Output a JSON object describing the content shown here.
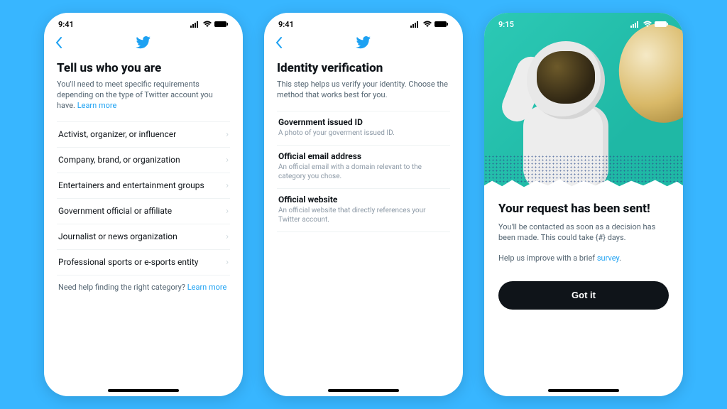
{
  "phone1": {
    "time": "9:41",
    "header_logo": "twitter",
    "title": "Tell us who you are",
    "desc_pre": "You'll need to meet specific requirements depending on the type of Twitter account you have. ",
    "learn_more": "Learn more",
    "categories": [
      "Activist, organizer, or influencer",
      "Company, brand, or organization",
      "Entertainers and entertainment groups",
      "Government official or affiliate",
      "Journalist or news organization",
      "Professional sports or e-sports entity"
    ],
    "help_pre": "Need help finding the right category? ",
    "help_link": "Learn more"
  },
  "phone2": {
    "time": "9:41",
    "title": "Identity verification",
    "desc": "This step helps us verify your identity. Choose the method that works best for you.",
    "methods": [
      {
        "title": "Government issued ID",
        "sub": "A photo of your goverment issued ID."
      },
      {
        "title": "Official email address",
        "sub": "An official email with a domain relevant to the category you chose."
      },
      {
        "title": "Official website",
        "sub": "An official website that directly references your Twitter account."
      }
    ]
  },
  "phone3": {
    "time": "9:15",
    "title": "Your request has been sent!",
    "desc": "You'll be contacted as soon as a decision has been made. This could take {#} days.",
    "survey_pre": "Help us improve with a brief ",
    "survey_link": "survey",
    "survey_post": ".",
    "cta": "Got it"
  }
}
